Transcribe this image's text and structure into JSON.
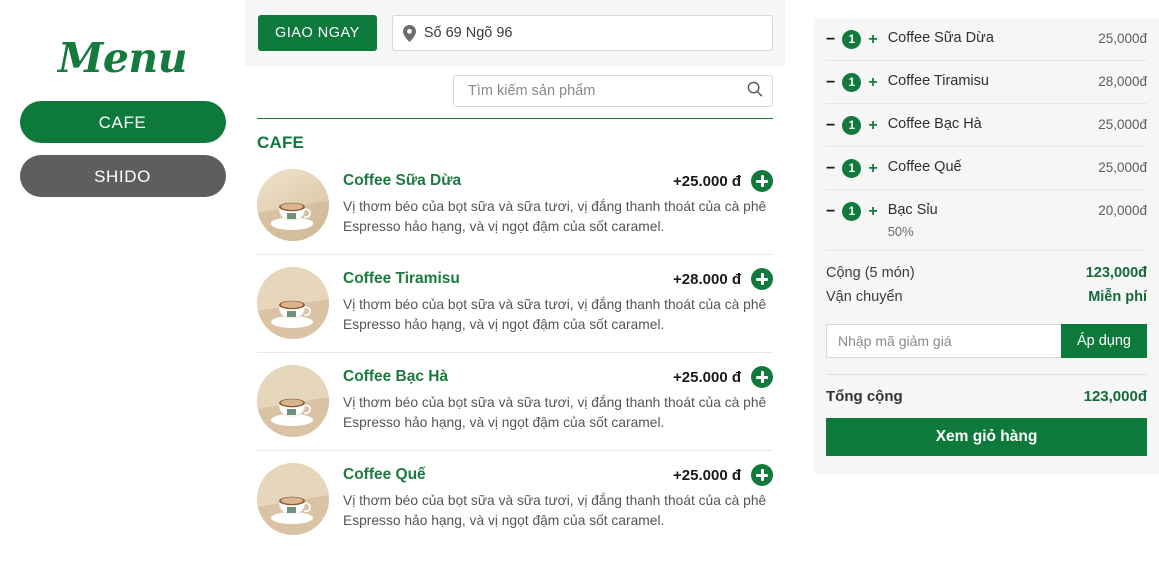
{
  "sidebar": {
    "brand": "Menu",
    "nav": [
      {
        "label": "CAFE",
        "state": "active"
      },
      {
        "label": "SHIDO",
        "state": "inactive"
      }
    ]
  },
  "delivery": {
    "button_label": "GIAO NGAY",
    "address_value": "Số 69 Ngõ 96",
    "pin_icon": "map-pin-icon"
  },
  "search": {
    "placeholder": "Tìm kiếm sản phẩm",
    "value": "",
    "icon": "search-icon"
  },
  "catalog": {
    "category_title": "CAFE",
    "shared_description": "Vị thơm béo của bọt sữa và sữa tươi, vị đắng thanh thoát của cà phê Espresso hảo hạng, và vị ngọt đậm của sốt caramel.",
    "items": [
      {
        "name": "Coffee Sữa Dừa",
        "price": "+25.000 đ",
        "desc": "Vị thơm béo của bọt sữa và sữa tươi, vị đắng thanh thoát của cà phê Espresso hảo hạng, và vị ngọt đậm của sốt caramel.",
        "add_icon": "plus-circle-icon",
        "thumb": "coffee-cup-photo"
      },
      {
        "name": "Coffee Tiramisu",
        "price": "+28.000 đ",
        "desc": "Vị thơm béo của bọt sữa và sữa tươi, vị đắng thanh thoát của cà phê Espresso hảo hạng, và vị ngọt đậm của sốt caramel.",
        "add_icon": "plus-circle-icon",
        "thumb": "coffee-cup-photo"
      },
      {
        "name": "Coffee Bạc Hà",
        "price": "+25.000 đ",
        "desc": "Vị thơm béo của bọt sữa và sữa tươi, vị đắng thanh thoát của cà phê Espresso hảo hạng, và vị ngọt đậm của sốt caramel.",
        "add_icon": "plus-circle-icon",
        "thumb": "coffee-cup-photo"
      },
      {
        "name": "Coffee Quế",
        "price": "+25.000 đ",
        "desc": "Vị thơm béo của bọt sữa và sữa tươi, vị đắng thanh thoát của cà phê Espresso hảo hạng, và vị ngọt đậm của sốt caramel.",
        "add_icon": "plus-circle-icon",
        "thumb": "coffee-cup-photo"
      }
    ]
  },
  "cart": {
    "decrease_symbol": "−",
    "increase_symbol": "+",
    "items": [
      {
        "qty": "1",
        "name": "Coffee Sữa Dừa",
        "note": "",
        "price": "25,000đ"
      },
      {
        "qty": "1",
        "name": "Coffee Tiramisu",
        "note": "",
        "price": "28,000đ"
      },
      {
        "qty": "1",
        "name": "Coffee Bạc Hà",
        "note": "",
        "price": "25,000đ"
      },
      {
        "qty": "1",
        "name": "Coffee Quế",
        "note": "",
        "price": "25,000đ"
      },
      {
        "qty": "1",
        "name": "Bạc Sỉu",
        "note": "50%",
        "price": "20,000đ"
      }
    ],
    "subtotal_label": "Cộng (5 món)",
    "subtotal_value": "123,000đ",
    "shipping_label": "Vận chuyển",
    "shipping_value": "Miễn phí",
    "promo_placeholder": "Nhập mã giảm giá",
    "promo_value": "",
    "promo_button": "Áp dụng",
    "total_label": "Tổng cộng",
    "total_value": "123,000đ",
    "view_cart_button": "Xem giỏ hàng"
  },
  "colors": {
    "brand_green": "#0d7a3c",
    "dark_green": "#146b37",
    "inactive_gray": "#5e5e5e",
    "panel_bg": "#f6f6f6"
  }
}
